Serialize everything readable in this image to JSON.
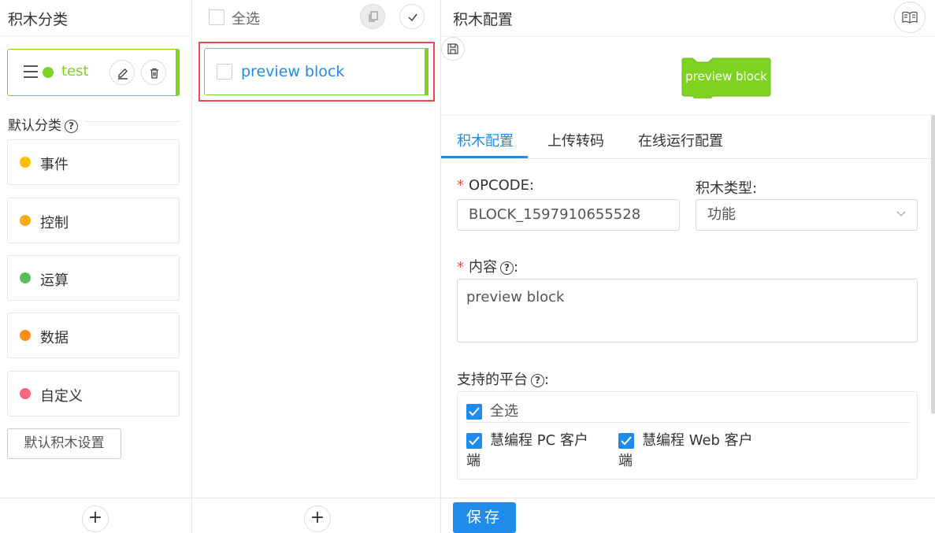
{
  "left_panel": {
    "title": "积木分类",
    "custom_category": {
      "label": "test",
      "color": "#7ed321"
    },
    "default_section_label": "默认分类",
    "default_categories": [
      {
        "label": "事件",
        "color": "#ffbf00"
      },
      {
        "label": "控制",
        "color": "#ffab19"
      },
      {
        "label": "运算",
        "color": "#59c059"
      },
      {
        "label": "数据",
        "color": "#ff8c1a"
      },
      {
        "label": "自定义",
        "color": "#ff6680"
      }
    ],
    "default_settings_button": "默认积木设置",
    "add_button": "+"
  },
  "middle_panel": {
    "select_all_label": "全选",
    "blocks": [
      {
        "label": "preview block",
        "color": "#7ed321"
      }
    ],
    "add_button": "+"
  },
  "right_panel": {
    "title": "积木配置",
    "preview_block_label": "preview block",
    "tabs": [
      {
        "label": "积木配置",
        "active": true
      },
      {
        "label": "上传转码",
        "active": false
      },
      {
        "label": "在线运行配置",
        "active": false
      }
    ],
    "form": {
      "required_mark": "*",
      "opcode_label": "OPCODE:",
      "opcode_value": "BLOCK_1597910655528",
      "block_type_label": "积木类型:",
      "block_type_value": "功能",
      "content_label": "内容",
      "content_label_suffix": ":",
      "content_value": "preview block",
      "platforms_label": "支持的平台",
      "platforms_label_suffix": ":",
      "platform_select_all": "全选",
      "platforms": [
        {
          "label_line1": "慧编程 PC 客户",
          "label_line2": "端",
          "checked": true
        },
        {
          "label_line1": "慧编程 Web 客户",
          "label_line2": "端",
          "checked": true
        }
      ]
    },
    "save_button": "保存",
    "accent_color": "#1f8ceb"
  }
}
